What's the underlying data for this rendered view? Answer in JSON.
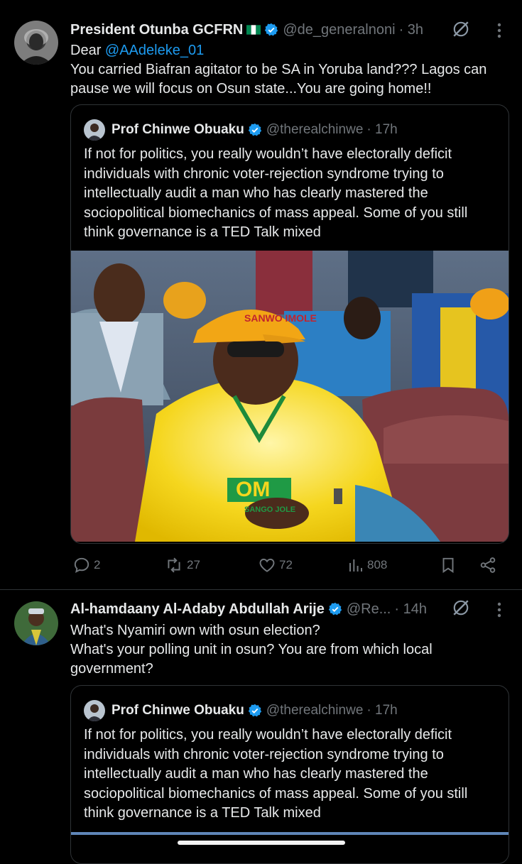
{
  "tweets": [
    {
      "name": "President Otunba GCFRN",
      "handle": "@de_generalnoni",
      "time": "· 3h",
      "text_prefix": "Dear ",
      "mention": "@AAdeleke_01",
      "text_body": "You carried Biafran agitator to be SA in Yoruba land??? Lagos can pause we will focus on Osun state...You are going home!!",
      "quote": {
        "name": "Prof Chinwe Obuaku",
        "handle": "@therealchinwe",
        "time": "· 17h",
        "text": "If not for politics, you really wouldn’t have electorally deficit individuals with chronic voter-rejection syndrome trying to intellectually audit a man who has clearly mastered the sociopolitical biomechanics of mass appeal. Some of you still think governance is a TED Talk mixed"
      },
      "photo_cap_text": "SANWO IMOLE",
      "photo_shirt_text": "OM",
      "photo_shirt_subtext": "SANGO JOLE",
      "actions": {
        "replies": "2",
        "reposts": "27",
        "likes": "72",
        "views": "808"
      }
    },
    {
      "name": "Al-hamdaany Al-Adaby Abdullah Arije",
      "handle": "@Re...",
      "time": "· 14h",
      "text": "What's Nyamiri own with osun election?\nWhat's your polling unit in osun? You are from which local government?",
      "quote": {
        "name": "Prof Chinwe Obuaku",
        "handle": "@therealchinwe",
        "time": "· 17h",
        "text": "If not for politics, you really wouldn’t have electorally deficit individuals with chronic voter-rejection syndrome trying to intellectually audit a man who has clearly mastered the sociopolitical biomechanics of mass appeal. Some of you still think governance is a TED Talk mixed"
      }
    }
  ],
  "colors": {
    "background": "#000000",
    "text": "#e7e9ea",
    "muted": "#71767b",
    "link": "#1d9bf0",
    "verified": "#1d9bf0",
    "border": "#2f3336"
  }
}
